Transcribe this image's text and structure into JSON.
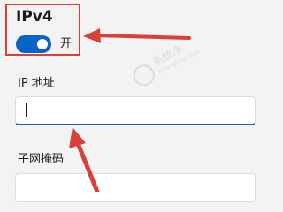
{
  "ipv4": {
    "title": "IPv4",
    "toggle_on": true,
    "toggle_state_label": "开"
  },
  "ip_address": {
    "label": "IP 地址",
    "value": ""
  },
  "subnet_mask": {
    "label": "子网掩码",
    "value": ""
  },
  "watermark": {
    "text": "系统净",
    "url": "xitongjing.com"
  },
  "colors": {
    "accent": "#0a63c9",
    "annotation": "#d9403a"
  }
}
